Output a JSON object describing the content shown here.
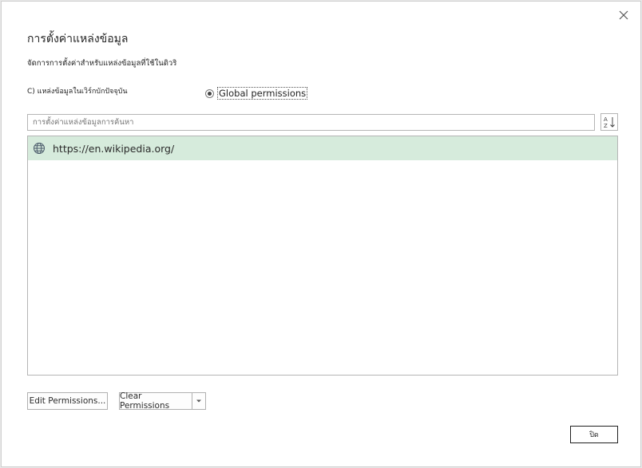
{
  "dialog": {
    "title": "การตั้งค่าแหล่งข้อมูล",
    "subtitle": "จัดการการตั้งค่าสำหรับแหล่งข้อมูลที่ใช้ในดิวริ",
    "scope_current_label": "C) แหล่งข้อมูลในเวิร์กบักปัจจุบัน",
    "scope_global_label": "Global permissions",
    "search_placeholder": "การตั้งค่าแหล่งข้อมูลการค้นหา",
    "sources": [
      {
        "url": "https://en.wikipedia.org/",
        "icon": "globe-icon",
        "selected": true
      }
    ],
    "edit_button_label": "Edit Permissions...",
    "clear_button_label": "Clear Permissions",
    "ok_button_label": "ปิด"
  },
  "colors": {
    "selected_row": "#d6ebdc",
    "border": "#b5b5b5"
  }
}
